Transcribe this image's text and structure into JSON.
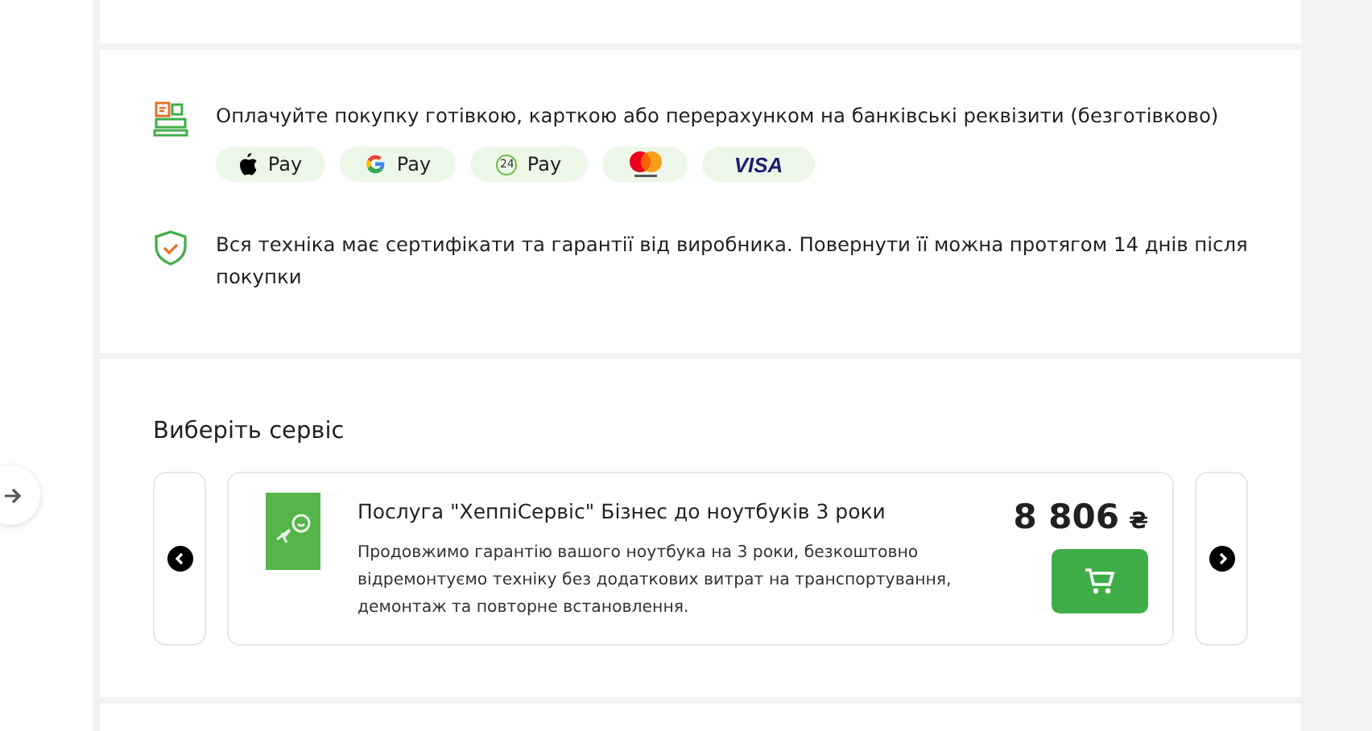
{
  "payment": {
    "text": "Оплачуйте покупку готівкою, карткою або перерахунком на банківські реквізити (безготівково)",
    "methods": [
      {
        "kind": "apple",
        "label": "Pay"
      },
      {
        "kind": "google",
        "label": "Pay"
      },
      {
        "kind": "p24",
        "badge": "24",
        "label": "Pay"
      },
      {
        "kind": "mastercard"
      },
      {
        "kind": "visa",
        "label": "VISA"
      }
    ]
  },
  "warranty": {
    "text": "Вся техніка має сертифікати та гарантії від виробника. Повернути її можна протягом 14 днів після покупки"
  },
  "services": {
    "title": "Виберіть сервіс",
    "items": [
      {
        "name": "Послуга \"ХеппіСервіс\" Бізнес до ноутбуків 3 роки",
        "description": "Продовжимо гарантію вашого ноутбука на 3 роки, безкоштовно відремонтуємо техніку без додаткових витрат на транспортування, демонтаж та повторне встановлення.",
        "price": "8 806",
        "currency": "₴"
      }
    ]
  }
}
